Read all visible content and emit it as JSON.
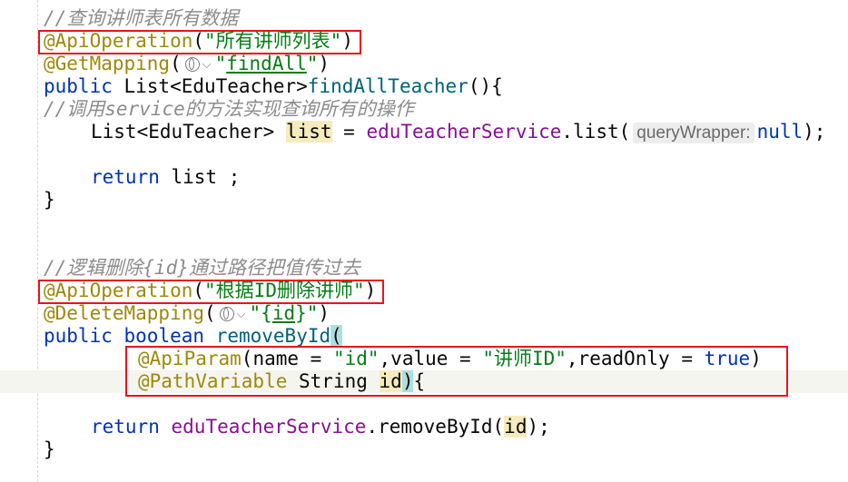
{
  "code": {
    "l1_comment": "//查询讲师表所有数据",
    "l2_anno": "@ApiOperation",
    "l2_open": "(",
    "l2_str": "\"所有讲师列表\"",
    "l2_close": ")",
    "l3_anno": "@GetMapping",
    "l3_open": "(",
    "l3_q1": "\"",
    "l3_path": "findAll",
    "l3_q2": "\"",
    "l3_close": ")",
    "l4_kw": "public",
    "l4_rest": " List<EduTeacher>",
    "l4_method": "findAllTeacher",
    "l4_end": "(){",
    "l5_comment": "//调用service的方法实现查询所有的操作",
    "l6_type": "List<EduTeacher> ",
    "l6_var": "list",
    "l6_eq": " = ",
    "l6_field": "eduTeacherService",
    "l6_call": ".list(",
    "l6_hint": "queryWrapper:",
    "l6_null": "null",
    "l6_end": ");",
    "l8_kw": "return",
    "l8_rest": " list ;",
    "l9_brace": "}",
    "l12_comment": "//逻辑删除{id}通过路径把值传过去",
    "l13_anno": "@ApiOperation",
    "l13_open": "(",
    "l13_str": "\"根据ID删除讲师\"",
    "l13_close": ")",
    "l14_anno": "@DeleteMapping",
    "l14_open": "(",
    "l14_q1": "\"{",
    "l14_path": "id",
    "l14_q2": "}\"",
    "l14_close": ")",
    "l15_kw1": "public",
    "l15_kw2": "boolean",
    "l15_method": "removeById",
    "l15_paren": "(",
    "l16_anno": "@ApiParam",
    "l16_a": "(name = ",
    "l16_s1": "\"id\"",
    "l16_b": ",value = ",
    "l16_s2": "\"讲师ID\"",
    "l16_c": ",readOnly = ",
    "l16_true": "true",
    "l16_d": ")",
    "l17_anno": "@PathVariable",
    "l17_type": " String ",
    "l17_var": "id",
    "l17_paren": ")",
    "l17_brace": "{",
    "l19_kw": "return",
    "l19_field": "eduTeacherService",
    "l19_call": ".removeById(",
    "l19_var": "id",
    "l19_end": ");",
    "l20_brace": "}"
  },
  "colors": {
    "keyword": "#0033b3",
    "annotation": "#9e880d",
    "string": "#067d17",
    "field": "#871094",
    "comment": "#8c8c8c",
    "highlight_box": "#e8141c"
  },
  "icons": [
    "globe-icon",
    "chevron-down-icon"
  ]
}
